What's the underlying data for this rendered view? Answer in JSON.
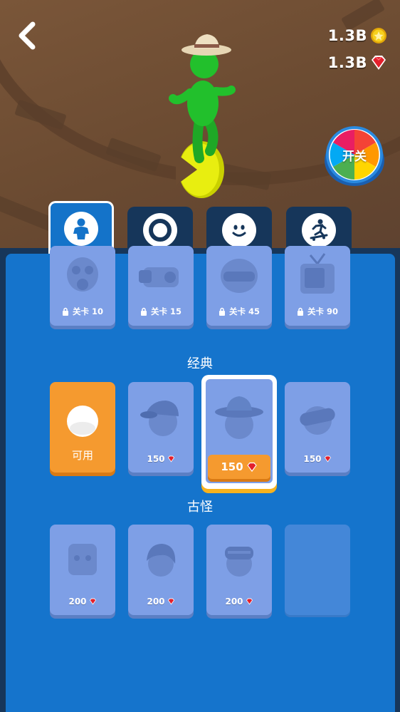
{
  "header": {
    "back_icon": "chevron-left-icon",
    "coins": "1.3B",
    "coins_icon": "coin-icon",
    "gems": "1.3B",
    "gems_icon": "gem-icon",
    "wheel_label": "开关"
  },
  "tabs": [
    {
      "name": "outfit",
      "icon": "person-icon",
      "active": true
    },
    {
      "name": "wheel",
      "icon": "ring-icon",
      "active": false
    },
    {
      "name": "face",
      "icon": "smiley-icon",
      "active": false
    },
    {
      "name": "skate",
      "icon": "skateboarder-icon",
      "active": false
    }
  ],
  "locked_items": [
    {
      "icon": "gas-mask-icon",
      "lock_label": "关卡 10"
    },
    {
      "icon": "vr-goggles-icon",
      "lock_label": "关卡 15"
    },
    {
      "icon": "helmet-icon",
      "lock_label": "关卡 45"
    },
    {
      "icon": "tv-head-icon",
      "lock_label": "关卡 90"
    }
  ],
  "sections": {
    "classic": {
      "title": "经典",
      "items": [
        {
          "icon": "plain-head-icon",
          "label": "可用",
          "state": "available"
        },
        {
          "icon": "cap-icon",
          "price": "150",
          "state": "buy"
        },
        {
          "icon": "fedora-icon",
          "price": "150",
          "state": "selected"
        },
        {
          "icon": "goggles-icon",
          "price": "150",
          "state": "buy"
        }
      ]
    },
    "weird": {
      "title": "古怪",
      "items": [
        {
          "icon": "box-head-icon",
          "price": "200",
          "state": "buy"
        },
        {
          "icon": "hair-icon",
          "price": "200",
          "state": "buy"
        },
        {
          "icon": "bandage-head-icon",
          "price": "200",
          "state": "buy"
        },
        {
          "icon": "empty-slot",
          "state": "empty"
        }
      ]
    }
  },
  "colors": {
    "panel": "#1574cc",
    "card": "#7e9fe6",
    "orange": "#f59a2f",
    "gem": "#e3202c",
    "coin": "#f6c51a",
    "character": "#22c02c"
  }
}
